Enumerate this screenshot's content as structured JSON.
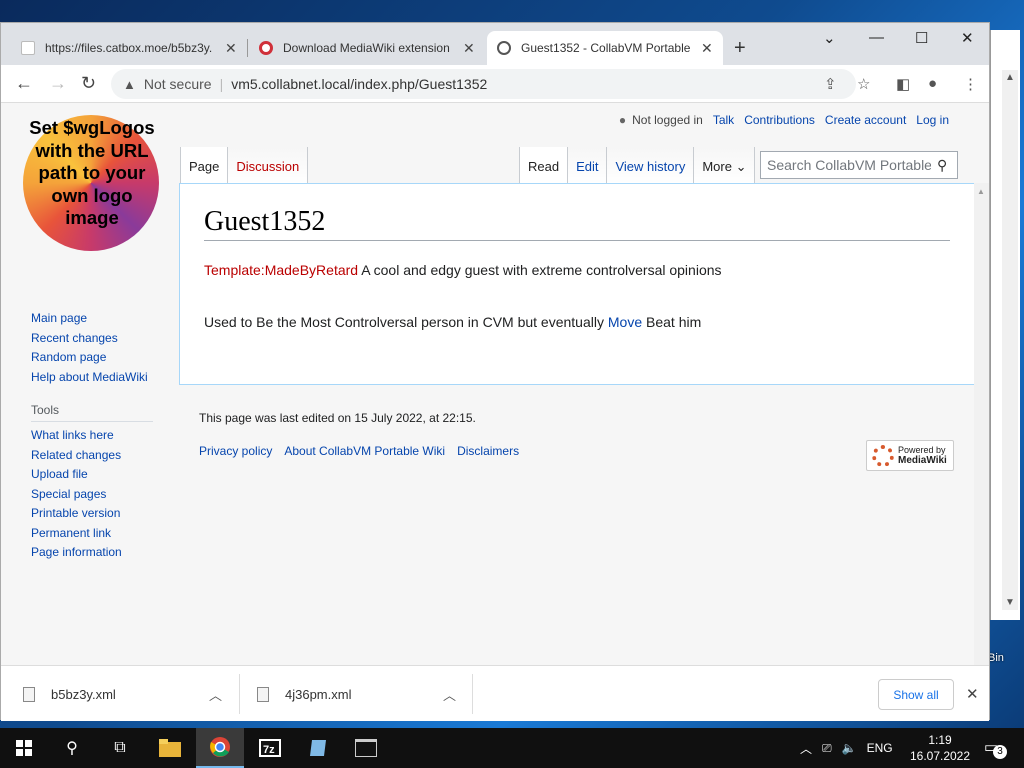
{
  "colors": {
    "link": "#0645ad",
    "redlink": "#ba0000",
    "chrome_tabstrip": "#dee1e6",
    "taskbar": "#101010",
    "accent": "#1a73e8"
  },
  "browser": {
    "tabs": [
      {
        "title": "https://files.catbox.moe/b5bz3y.",
        "favicon": "xml-file-icon",
        "active": false
      },
      {
        "title": "Download MediaWiki extension",
        "favicon": "opera-red-icon",
        "active": false
      },
      {
        "title": "Guest1352 - CollabVM Portable",
        "favicon": "globe-icon",
        "active": true
      }
    ],
    "security_label": "Not secure",
    "url": "vm5.collabnet.local/index.php/Guest1352"
  },
  "wiki": {
    "logo_text": "Set $wgLogos with the URL path to your own logo image",
    "personal": {
      "not_logged_in": "Not logged in",
      "talk": "Talk",
      "contributions": "Contributions",
      "create_account": "Create account",
      "log_in": "Log in"
    },
    "left_tabs": {
      "page": "Page",
      "discussion": "Discussion"
    },
    "right_tabs": {
      "read": "Read",
      "edit": "Edit",
      "history": "View history",
      "more": "More"
    },
    "search_placeholder": "Search CollabVM Portable Wiki",
    "title": "Guest1352",
    "para1": {
      "template_link": "Template:MadeByRetard",
      "text": " A cool and edgy guest with extreme controlversal opinions"
    },
    "para2": {
      "before": "Used to Be the Most Controlversal person in CVM but eventually ",
      "link": "Move",
      "after": " Beat him"
    },
    "navigation": [
      "Main page",
      "Recent changes",
      "Random page",
      "Help about MediaWiki"
    ],
    "tools_heading": "Tools",
    "tools": [
      "What links here",
      "Related changes",
      "Upload file",
      "Special pages",
      "Printable version",
      "Permanent link",
      "Page information"
    ],
    "footer": {
      "last_edited": "This page was last edited on 15 July 2022, at 22:15.",
      "links": [
        "Privacy policy",
        "About CollabVM Portable Wiki",
        "Disclaimers"
      ],
      "powered_line1": "Powered by",
      "powered_line2": "MediaWiki"
    }
  },
  "downloads": {
    "items": [
      "b5bz3y.xml",
      "4j36pm.xml"
    ],
    "show_all": "Show all"
  },
  "desktop": {
    "recycle_label": "Bin"
  },
  "taskbar": {
    "language": "ENG",
    "time": "1:19",
    "date": "16.07.2022",
    "notification_count": "3"
  }
}
